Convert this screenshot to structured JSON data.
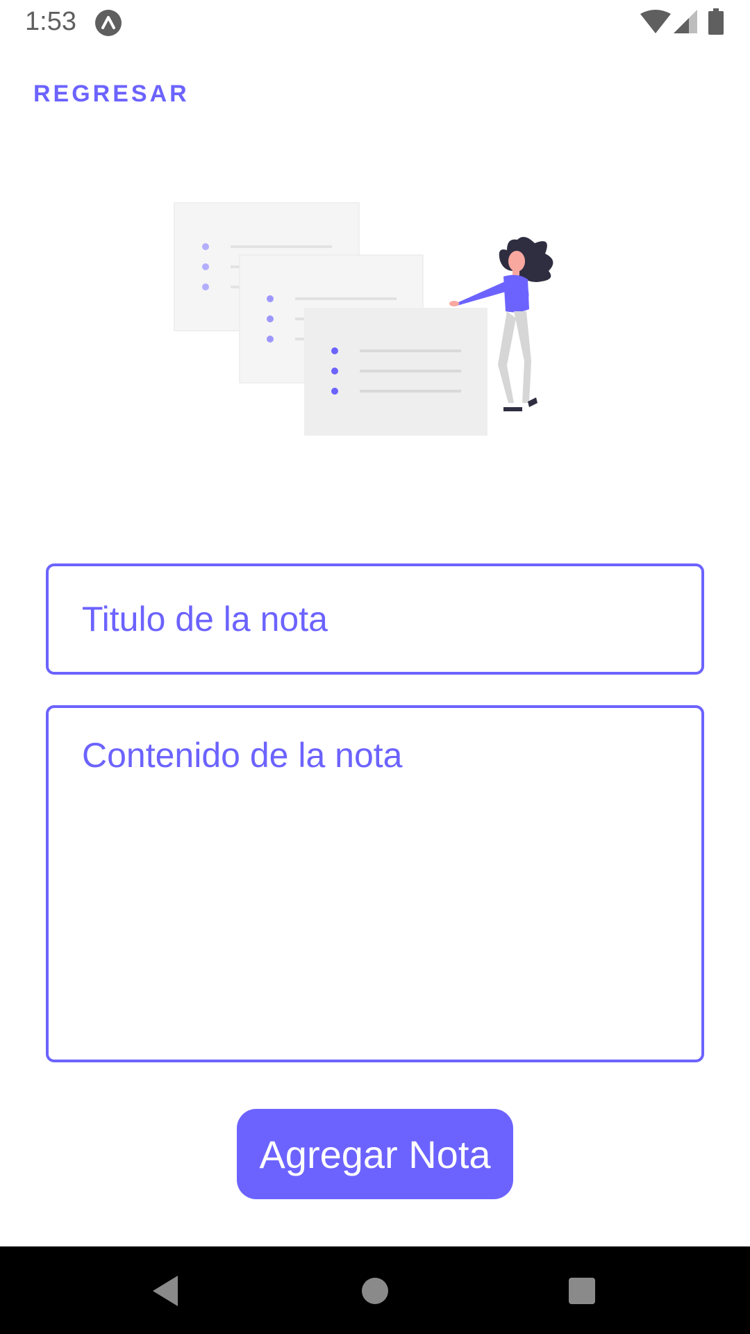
{
  "status_bar": {
    "time": "1:53",
    "app_icon": "expo-icon",
    "wifi_icon": "wifi-icon",
    "signal_icon": "cell-signal-icon",
    "battery_icon": "battery-icon"
  },
  "header": {
    "back_label": "REGRESAR"
  },
  "illustration": {
    "name": "notes-illustration"
  },
  "form": {
    "title_placeholder": "Titulo de la nota",
    "title_value": "",
    "content_placeholder": "Contenido de la nota",
    "content_value": "",
    "submit_label": "Agregar Nota"
  },
  "nav_bar": {
    "back_icon": "nav-back-icon",
    "home_icon": "nav-home-icon",
    "recents_icon": "nav-recents-icon"
  },
  "colors": {
    "accent": "#6c63ff",
    "background": "#ffffff",
    "nav_bar": "#000000"
  }
}
